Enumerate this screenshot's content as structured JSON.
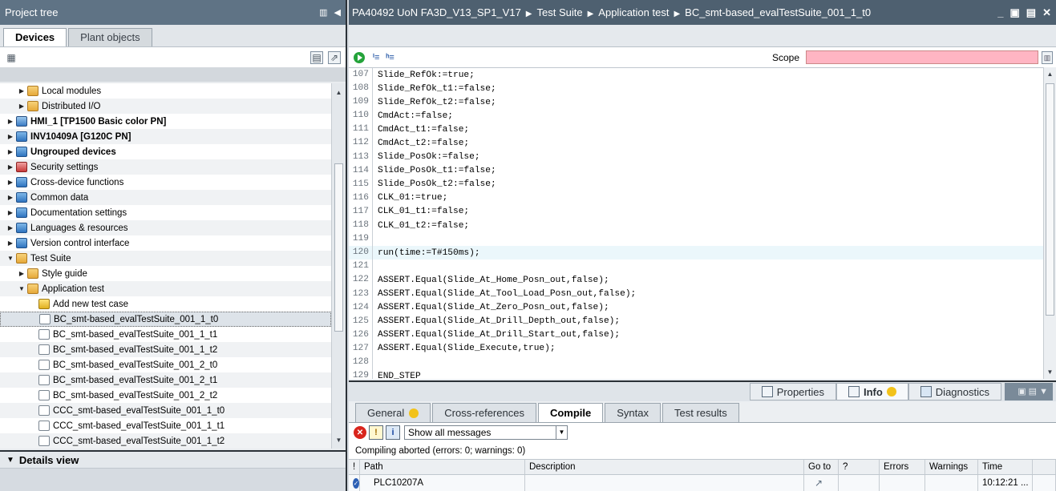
{
  "project_tree": {
    "title": "Project tree",
    "tabs": [
      {
        "label": "Devices",
        "active": true
      },
      {
        "label": "Plant objects",
        "active": false
      }
    ],
    "items": [
      {
        "label": "Local modules",
        "indent": 2,
        "icon": "module-icon",
        "arrow": "right",
        "bold": false
      },
      {
        "label": "Distributed I/O",
        "indent": 2,
        "icon": "distributed-io-icon",
        "arrow": "right",
        "bold": false
      },
      {
        "label": "HMI_1 [TP1500 Basic color PN]",
        "indent": 1,
        "icon": "hmi-icon",
        "arrow": "right",
        "bold": true
      },
      {
        "label": "INV10409A [G120C PN]",
        "indent": 1,
        "icon": "drive-icon",
        "arrow": "right",
        "bold": true
      },
      {
        "label": "Ungrouped devices",
        "indent": 1,
        "icon": "ungrouped-devices-icon",
        "arrow": "right",
        "bold": true
      },
      {
        "label": "Security settings",
        "indent": 1,
        "icon": "security-icon",
        "arrow": "right",
        "bold": false
      },
      {
        "label": "Cross-device functions",
        "indent": 1,
        "icon": "cross-device-icon",
        "arrow": "right",
        "bold": false
      },
      {
        "label": "Common data",
        "indent": 1,
        "icon": "common-data-icon",
        "arrow": "right",
        "bold": false
      },
      {
        "label": "Documentation settings",
        "indent": 1,
        "icon": "documentation-icon",
        "arrow": "right",
        "bold": false
      },
      {
        "label": "Languages & resources",
        "indent": 1,
        "icon": "languages-icon",
        "arrow": "right",
        "bold": false
      },
      {
        "label": "Version control interface",
        "indent": 1,
        "icon": "version-control-icon",
        "arrow": "right",
        "bold": false
      },
      {
        "label": "Test Suite",
        "indent": 1,
        "icon": "test-suite-icon",
        "arrow": "down",
        "bold": false
      },
      {
        "label": "Style guide",
        "indent": 2,
        "icon": "style-guide-icon",
        "arrow": "right",
        "bold": false
      },
      {
        "label": "Application test",
        "indent": 2,
        "icon": "application-test-icon",
        "arrow": "down",
        "bold": false
      },
      {
        "label": "Add new test case",
        "indent": 3,
        "icon": "add-test-case-icon",
        "arrow": "",
        "bold": false
      },
      {
        "label": "BC_smt-based_evalTestSuite_001_1_t0",
        "indent": 3,
        "icon": "test-case-icon",
        "arrow": "",
        "bold": false,
        "selected": true
      },
      {
        "label": "BC_smt-based_evalTestSuite_001_1_t1",
        "indent": 3,
        "icon": "test-case-icon",
        "arrow": "",
        "bold": false
      },
      {
        "label": "BC_smt-based_evalTestSuite_001_1_t2",
        "indent": 3,
        "icon": "test-case-icon",
        "arrow": "",
        "bold": false
      },
      {
        "label": "BC_smt-based_evalTestSuite_001_2_t0",
        "indent": 3,
        "icon": "test-case-icon",
        "arrow": "",
        "bold": false
      },
      {
        "label": "BC_smt-based_evalTestSuite_001_2_t1",
        "indent": 3,
        "icon": "test-case-icon",
        "arrow": "",
        "bold": false
      },
      {
        "label": "BC_smt-based_evalTestSuite_001_2_t2",
        "indent": 3,
        "icon": "test-case-icon",
        "arrow": "",
        "bold": false
      },
      {
        "label": "CCC_smt-based_evalTestSuite_001_1_t0",
        "indent": 3,
        "icon": "test-case-icon",
        "arrow": "",
        "bold": false
      },
      {
        "label": "CCC_smt-based_evalTestSuite_001_1_t1",
        "indent": 3,
        "icon": "test-case-icon",
        "arrow": "",
        "bold": false
      },
      {
        "label": "CCC_smt-based_evalTestSuite_001_1_t2",
        "indent": 3,
        "icon": "test-case-icon",
        "arrow": "",
        "bold": false
      }
    ],
    "details_view": "Details view"
  },
  "editor": {
    "breadcrumb": [
      "PA40492 UoN FA3D_V13_SP1_V17",
      "Test Suite",
      "Application test",
      "BC_smt-based_evalTestSuite_001_1_t0"
    ],
    "scope_label": "Scope",
    "lines": [
      {
        "n": "107",
        "text": "Slide_RefOk:=true;"
      },
      {
        "n": "108",
        "text": "Slide_RefOk_t1:=false;"
      },
      {
        "n": "109",
        "text": "Slide_RefOk_t2:=false;"
      },
      {
        "n": "110",
        "text": "CmdAct:=false;"
      },
      {
        "n": "111",
        "text": "CmdAct_t1:=false;"
      },
      {
        "n": "112",
        "text": "CmdAct_t2:=false;"
      },
      {
        "n": "113",
        "text": "Slide_PosOk:=false;"
      },
      {
        "n": "114",
        "text": "Slide_PosOk_t1:=false;"
      },
      {
        "n": "115",
        "text": "Slide_PosOk_t2:=false;"
      },
      {
        "n": "116",
        "text": "CLK_01:=true;"
      },
      {
        "n": "117",
        "text": "CLK_01_t1:=false;"
      },
      {
        "n": "118",
        "text": "CLK_01_t2:=false;"
      },
      {
        "n": "119",
        "text": ""
      },
      {
        "n": "120",
        "text": "run(time:=T#150ms);",
        "kw": "run",
        "highlight": true
      },
      {
        "n": "121",
        "text": ""
      },
      {
        "n": "122",
        "text": "ASSERT.Equal(Slide_At_Home_Posn_out,false);",
        "kw": "ASSERT"
      },
      {
        "n": "123",
        "text": "ASSERT.Equal(Slide_At_Tool_Load_Posn_out,false);",
        "kw": "ASSERT"
      },
      {
        "n": "124",
        "text": "ASSERT.Equal(Slide_At_Zero_Posn_out,false);",
        "kw": "ASSERT"
      },
      {
        "n": "125",
        "text": "ASSERT.Equal(Slide_At_Drill_Depth_out,false);",
        "kw": "ASSERT"
      },
      {
        "n": "126",
        "text": "ASSERT.Equal(Slide_At_Drill_Start_out,false);",
        "kw": "ASSERT"
      },
      {
        "n": "127",
        "text": "ASSERT.Equal(Slide_Execute,true);",
        "kw": "ASSERT"
      },
      {
        "n": "128",
        "text": ""
      },
      {
        "n": "129",
        "text": "END_STEP",
        "kw": "END_STEP"
      }
    ]
  },
  "inspector": {
    "tabs": [
      {
        "label": "Properties",
        "active": false
      },
      {
        "label": "Info",
        "active": true
      },
      {
        "label": "Diagnostics",
        "active": false
      }
    ],
    "sub_tabs": [
      {
        "label": "General",
        "active": false,
        "warn": true
      },
      {
        "label": "Cross-references",
        "active": false
      },
      {
        "label": "Compile",
        "active": true
      },
      {
        "label": "Syntax",
        "active": false
      },
      {
        "label": "Test results",
        "active": false
      }
    ],
    "filter_value": "Show all messages",
    "status": "Compiling aborted (errors: 0; warnings: 0)",
    "columns": [
      "!",
      "Path",
      "Description",
      "Go to",
      "?",
      "Errors",
      "Warnings",
      "Time"
    ],
    "rows": [
      {
        "path": "PLC10207A",
        "description": "",
        "goto": "↗",
        "q": "",
        "errors": "",
        "warnings": "",
        "time": "10:12:21 ..."
      }
    ]
  }
}
